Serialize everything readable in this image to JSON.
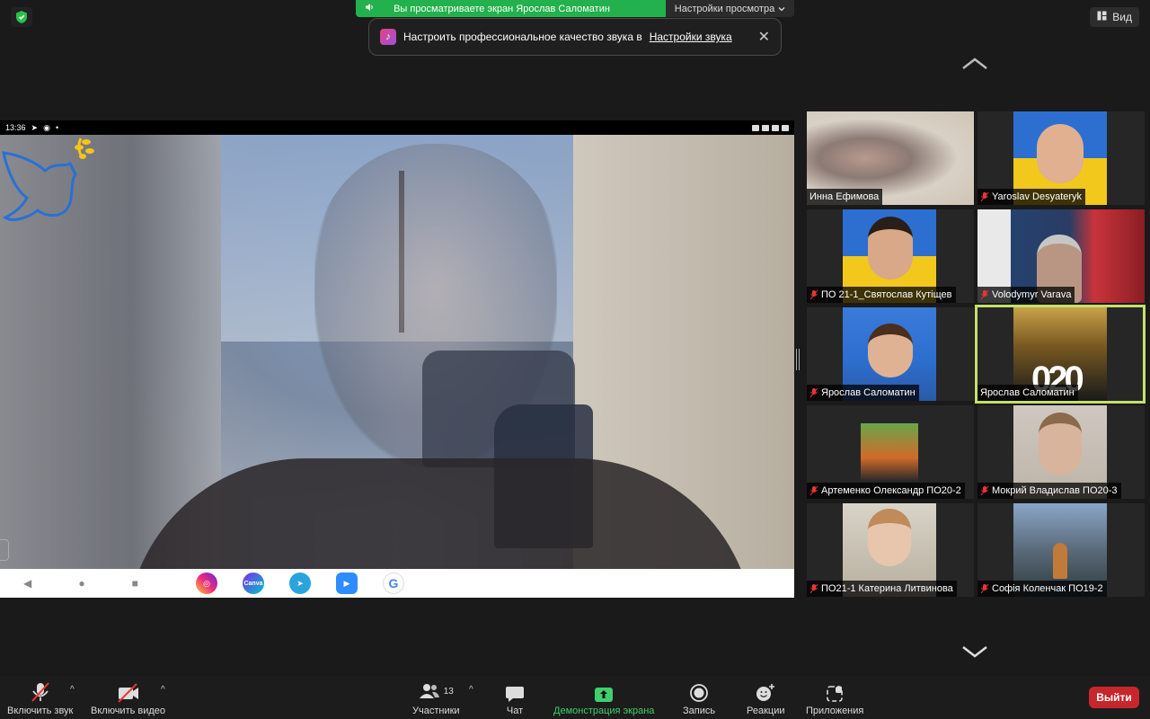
{
  "banner": {
    "sharing_text": "Вы просматриваете экран Ярослав Саломатин",
    "view_options": "Настройки просмотра"
  },
  "view_button": "Вид",
  "toast": {
    "text": "Настроить профессиональное качество звука в",
    "link": "Настройки звука"
  },
  "phone": {
    "time": "13:36",
    "apps": [
      "instagram",
      "Canva",
      "telegram",
      "zoom",
      "google"
    ]
  },
  "participants": [
    {
      "name": "Инна Ефимова",
      "muted": false
    },
    {
      "name": "Yaroslav Desyateryk",
      "muted": true
    },
    {
      "name": "ПО 21-1_Святослав Кутіщев",
      "muted": true
    },
    {
      "name": "Volodymyr Varava",
      "muted": true
    },
    {
      "name": "Ярослав Саломатин",
      "muted": true
    },
    {
      "name": "Ярослав Саломатин",
      "muted": false,
      "active": true
    },
    {
      "name": "Артеменко Олександр ПО20-2",
      "muted": true
    },
    {
      "name": "Мокрий Владислав ПО20-3",
      "muted": true
    },
    {
      "name": "ПО21-1 Катерина Литвинова",
      "muted": true
    },
    {
      "name": "Софія Коленчак ПО19-2",
      "muted": true
    }
  ],
  "toolbar": {
    "audio": "Включить звук",
    "video": "Включить видео",
    "participants": "Участники",
    "participants_count": "13",
    "chat": "Чат",
    "share": "Демонстрация экрана",
    "record": "Запись",
    "reactions": "Реакции",
    "apps": "Приложения",
    "leave": "Выйти"
  },
  "colors": {
    "share_green": "#22b14c",
    "active_speaker": "#c4e06a",
    "leave_red": "#c7262d"
  }
}
